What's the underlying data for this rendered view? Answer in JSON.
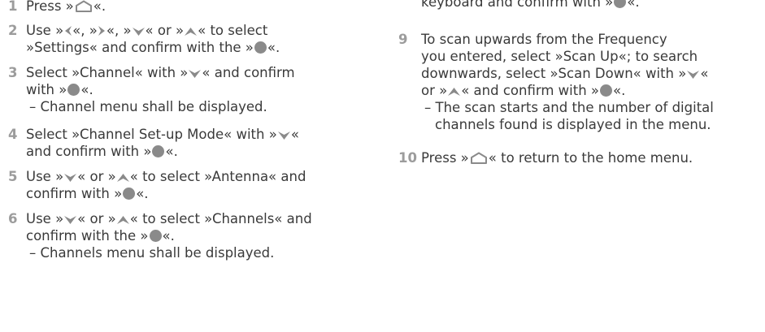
{
  "left_steps": [
    {
      "num": "1",
      "l1a": "Press »",
      "l1b": "«."
    },
    {
      "num": "2",
      "l1a": "Use »",
      "l1b": "«, »",
      "l1c": "«, »",
      "l1d": "« or »",
      "l1e": "« to select",
      "l2a": "»Settings« and confirm with the »",
      "l2b": "«."
    },
    {
      "num": "3",
      "l1a": "Select »Channel« with »",
      "l1b": "« and confirm",
      "l2a": "with »",
      "l2b": "«.",
      "l3": "– Channel menu shall be displayed."
    },
    {
      "num": "4",
      "l1a": "Select »Channel Set-up Mode« with »",
      "l1b": "«",
      "l2a": "and confirm with »",
      "l2b": "«."
    },
    {
      "num": "5",
      "l1a": "Use »",
      "l1b": "« or »",
      "l1c": "« to select »Antenna« and",
      "l2a": "confirm with »",
      "l2b": "«."
    },
    {
      "num": "6",
      "l1a": "Use »",
      "l1b": "« or »",
      "l1c": "« to select »Channels« and",
      "l2a": "confirm with the »",
      "l2b": "«.",
      "l3": "– Channels menu shall be displayed."
    }
  ],
  "right_top": {
    "a": "keyboard and confirm with »",
    "b": "«."
  },
  "right_steps": [
    {
      "num": "9",
      "l1": "To scan upwards from the Frequency",
      "l2": "you entered, select »Scan Up«; to search",
      "l3a": "downwards, select »Scan Down« with »",
      "l3b": "«",
      "l4a": "or »",
      "l4b": "« and confirm with »",
      "l4c": "«.",
      "l5": "– The scan starts and the number of digital",
      "l6": "channels found is displayed in the menu."
    },
    {
      "num": "10",
      "l1a": "Press »",
      "l1b": "« to return to the home menu."
    }
  ],
  "icons": {
    "home": "home-icon",
    "left": "arrow-left-icon",
    "right": "arrow-right-icon",
    "down": "arrow-down-icon",
    "up": "arrow-up-icon",
    "ok": "ok-button-icon"
  },
  "colors": {
    "text": "#3a3a3a",
    "step_number": "#9c9c9c",
    "icon": "#8a8a8a"
  }
}
